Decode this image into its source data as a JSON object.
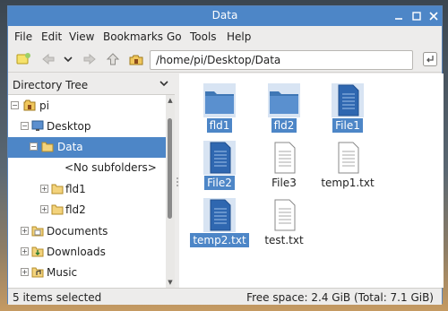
{
  "window": {
    "title": "Data"
  },
  "menu": [
    "File",
    "Edit",
    "View",
    "Bookmarks",
    "Go",
    "Tools",
    "Help"
  ],
  "toolbar": {
    "path": "/home/pi/Desktop/Data",
    "icons": [
      "new-tab-icon",
      "back-icon",
      "history-dropdown-icon",
      "forward-icon",
      "up-icon",
      "home-icon",
      "go-icon"
    ]
  },
  "sidebar": {
    "title": "Directory Tree",
    "tree": [
      {
        "label": "pi",
        "expander": "−",
        "icon": "home-folder-icon"
      },
      {
        "label": "Desktop",
        "expander": "−",
        "icon": "desktop-icon"
      },
      {
        "label": "Data",
        "expander": "−",
        "icon": "folder-icon",
        "selected": true
      },
      {
        "label": "<No subfolders>",
        "expander": "",
        "icon": ""
      },
      {
        "label": "fld1",
        "expander": "+",
        "icon": "folder-icon"
      },
      {
        "label": "fld2",
        "expander": "+",
        "icon": "folder-icon"
      },
      {
        "label": "Documents",
        "expander": "+",
        "icon": "documents-icon"
      },
      {
        "label": "Downloads",
        "expander": "+",
        "icon": "downloads-icon"
      },
      {
        "label": "Music",
        "expander": "+",
        "icon": "music-icon"
      }
    ]
  },
  "files": [
    {
      "name": "fld1",
      "type": "folder",
      "selected": true
    },
    {
      "name": "fld2",
      "type": "folder",
      "selected": true
    },
    {
      "name": "File1",
      "type": "document",
      "selected": true
    },
    {
      "name": "File2",
      "type": "document",
      "selected": true
    },
    {
      "name": "File3",
      "type": "text",
      "selected": false
    },
    {
      "name": "temp1.txt",
      "type": "text",
      "selected": false
    },
    {
      "name": "temp2.txt",
      "type": "document",
      "selected": true
    },
    {
      "name": "test.txt",
      "type": "text",
      "selected": false
    }
  ],
  "status": {
    "selection": "5 items selected",
    "free_space": "Free space: 2.4 GiB (Total: 7.1 GiB)"
  },
  "colors": {
    "accent": "#4d86c7",
    "folder": "#4f84bd",
    "document": "#2f67b0"
  }
}
